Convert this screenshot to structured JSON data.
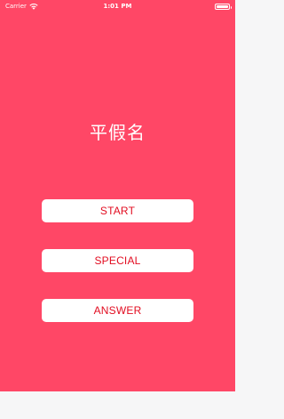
{
  "status_bar": {
    "carrier": "Carrier",
    "time": "1:01 PM",
    "wifi_icon": "wifi-icon",
    "battery_icon": "battery-icon",
    "battery_level": 1.0
  },
  "main": {
    "title": "平假名",
    "buttons": [
      {
        "label": "START"
      },
      {
        "label": "SPECIAL"
      },
      {
        "label": "ANSWER"
      }
    ]
  },
  "colors": {
    "background": "#ff4766",
    "button_background": "#ffffff",
    "button_text": "#e20d21",
    "bottom_bar": "#f6f6f7"
  }
}
